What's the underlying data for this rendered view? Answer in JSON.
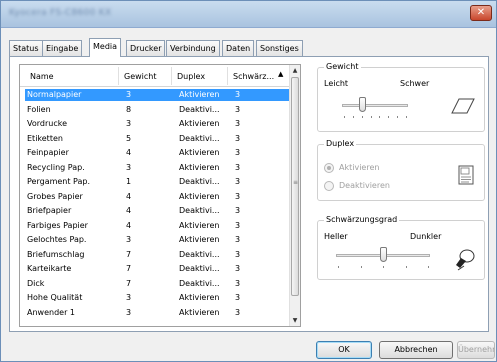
{
  "window": {
    "title": "Kyocera FS-C8600 KX",
    "close_label": "✕"
  },
  "tabs": [
    {
      "label": "Status"
    },
    {
      "label": "Eingabe"
    },
    {
      "label": "Media"
    },
    {
      "label": "Drucker"
    },
    {
      "label": "Verbindung"
    },
    {
      "label": "Daten"
    },
    {
      "label": "Sonstiges"
    }
  ],
  "active_tab": "Media",
  "media_list": {
    "columns": [
      "Name",
      "Gewicht",
      "Duplex",
      "Schwärz..."
    ],
    "rows": [
      [
        "Normalpapier",
        "3",
        "Aktivieren",
        "3"
      ],
      [
        "Folien",
        "8",
        "Deaktivi...",
        "3"
      ],
      [
        "Vordrucke",
        "3",
        "Aktivieren",
        "3"
      ],
      [
        "Etiketten",
        "5",
        "Deaktivi...",
        "3"
      ],
      [
        "Feinpapier",
        "4",
        "Aktivieren",
        "3"
      ],
      [
        "Recycling Pap.",
        "3",
        "Aktivieren",
        "3"
      ],
      [
        "Pergament Pap.",
        "1",
        "Deaktivi...",
        "3"
      ],
      [
        "Grobes Papier",
        "4",
        "Aktivieren",
        "3"
      ],
      [
        "Briefpapier",
        "4",
        "Deaktivi...",
        "3"
      ],
      [
        "Farbiges Papier",
        "4",
        "Aktivieren",
        "3"
      ],
      [
        "Gelochtes Pap.",
        "3",
        "Aktivieren",
        "3"
      ],
      [
        "Briefumschlag",
        "7",
        "Deaktivi...",
        "3"
      ],
      [
        "Karteikarte",
        "7",
        "Deaktivi...",
        "3"
      ],
      [
        "Dick",
        "7",
        "Deaktivi...",
        "3"
      ],
      [
        "Hohe Qualität",
        "3",
        "Aktivieren",
        "3"
      ],
      [
        "Anwender 1",
        "3",
        "Aktivieren",
        "3"
      ]
    ],
    "selected_index": 0
  },
  "gewicht": {
    "title": "Gewicht",
    "min_label": "Leicht",
    "max_label": "Schwer",
    "level": 3,
    "steps": 8,
    "icon": "paper-sheet-icon"
  },
  "duplex": {
    "title": "Duplex",
    "option_on": "Aktivieren",
    "option_off": "Deaktivieren",
    "selected": "on",
    "enabled": false,
    "icon": "duplex-document-icon"
  },
  "schwaerzungsgrad": {
    "title": "Schwärzungsgrad",
    "min_label": "Heller",
    "max_label": "Dunkler",
    "level": 3,
    "steps": 5,
    "icon": "toner-cartridge-icon"
  },
  "buttons": {
    "ok": "OK",
    "cancel": "Abbrechen",
    "apply": "Übernehmen"
  },
  "colors": {
    "selection": "#3399ff",
    "tab_border": "#8e9fb3",
    "title_bar": "#b9cfe6"
  }
}
